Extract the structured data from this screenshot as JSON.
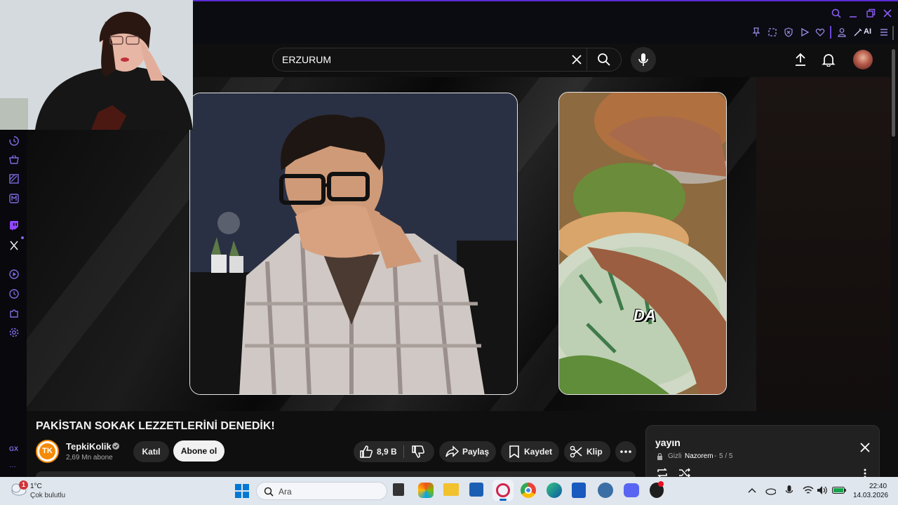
{
  "browser": {
    "toolbar_icons": [
      "pin-icon",
      "snapshot-icon",
      "shield-icon",
      "play-icon",
      "heart-icon",
      "profile-icon",
      "aria-icon",
      "menu-icon"
    ],
    "ai_label": "AI",
    "window_controls": [
      "search-icon",
      "minimize-icon",
      "restore-icon",
      "close-icon"
    ]
  },
  "sidebar": {
    "items": [
      "history-icon",
      "shopping-icon",
      "wallet-icon",
      "messenger-icon",
      "twitch-icon",
      "x-icon",
      "player-icon",
      "clock-icon",
      "extensions-icon",
      "settings-icon"
    ],
    "gx_label": "GX",
    "more_label": "···"
  },
  "youtube": {
    "search_value": "ERZURUM",
    "video_title": "PAKİSTAN SOKAK LEZZETLERİNİ DENEDİK!",
    "video_caption": "DA",
    "channel_name": "TepkiKolik",
    "channel_initials": "TK",
    "subscribers": "2,69 Mn abone",
    "join_label": "Katıl",
    "subscribe_label": "Abone ol",
    "likes": "8,9 B",
    "share_label": "Paylaş",
    "save_label": "Kaydet",
    "clip_label": "Klip"
  },
  "playlist": {
    "title": "yayın",
    "privacy": "Gizli",
    "owner": "Nazorem",
    "position": "5 / 5"
  },
  "taskbar": {
    "weather_temp": "1°C",
    "weather_desc": "Çok bulutlu",
    "weather_badge": "1",
    "search_placeholder": "Ara",
    "time": "22:40",
    "date": "14.03.2026"
  },
  "colors": {
    "accent": "#5b2bd6",
    "icon_purple": "#7c6be0",
    "subscribe_bg": "#f1f1f1",
    "channel_ring": "#f58a07"
  }
}
